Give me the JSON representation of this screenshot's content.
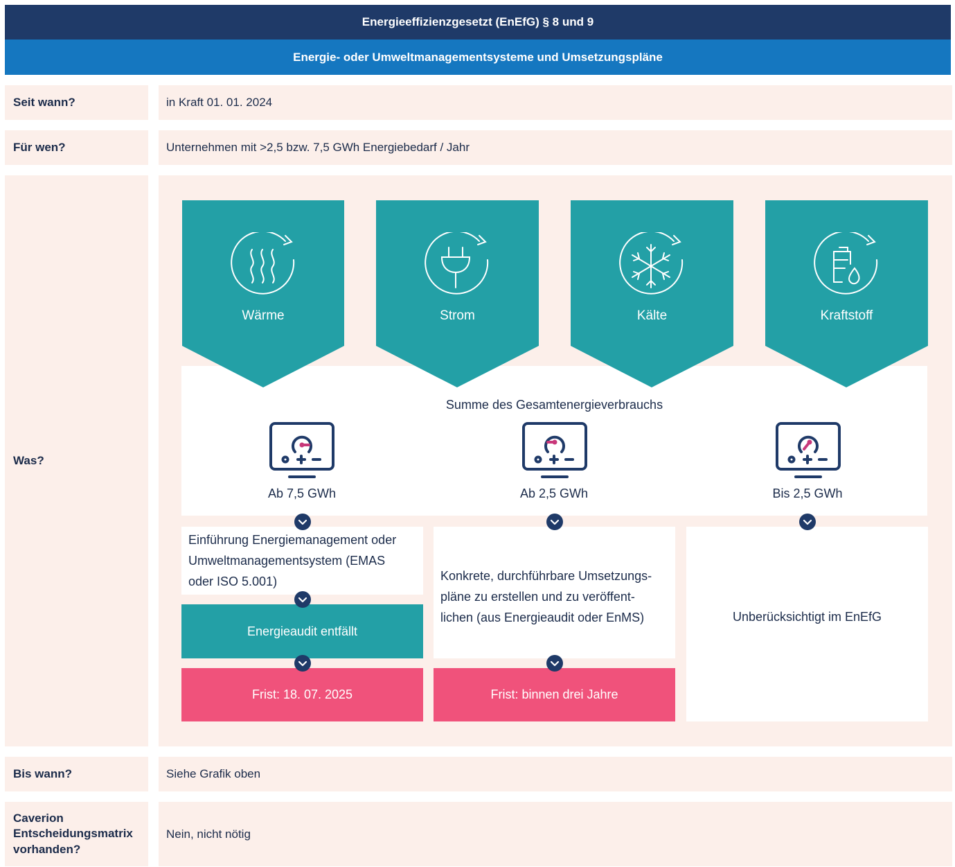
{
  "header": {
    "title": "Energieeffizienzgesetzt (EnEfG) § 8 und 9",
    "subtitle": "Energie- oder Umweltmanagementsysteme und Umsetzungspläne"
  },
  "rows": {
    "seit_wann": {
      "label": "Seit wann?",
      "value": "in Kraft 01. 01. 2024"
    },
    "fuer_wen": {
      "label": "Für wen?",
      "value": "Unternehmen mit >2,5 bzw. 7,5 GWh Energiebedarf / Jahr"
    },
    "was": {
      "label": "Was?"
    },
    "bis_wann": {
      "label": "Bis wann?",
      "value": "Siehe Grafik oben"
    },
    "matrix": {
      "label_1": "Caverion",
      "label_2": "Entscheidungsmatrix",
      "label_3": "vorhanden?",
      "value": "Nein, nicht nötig"
    }
  },
  "energy_types": [
    {
      "label": "Wärme",
      "icon": "heat-icon"
    },
    {
      "label": "Strom",
      "icon": "plug-icon"
    },
    {
      "label": "Kälte",
      "icon": "snowflake-icon"
    },
    {
      "label": "Kraftstoff",
      "icon": "fuel-icon"
    }
  ],
  "summary": {
    "title": "Summe des Gesamtenergieverbrauchs",
    "levels": [
      {
        "label": "Ab 7,5 GWh",
        "icon": "gauge-high-icon"
      },
      {
        "label": "Ab 2,5 GWh",
        "icon": "gauge-mid-icon"
      },
      {
        "label": "Bis 2,5 GWh",
        "icon": "gauge-low-icon"
      }
    ]
  },
  "outcomes": {
    "col1": {
      "line1": "Einführung Energiemanagement oder",
      "line2": "Umweltmanagementsystem (EMAS",
      "line3": "oder ISO 5.001)",
      "audit": "Energieaudit entfällt",
      "deadline": "Frist: 18. 07. 2025"
    },
    "col2": {
      "line1": "Konkrete, durchführbare Umsetzungs-",
      "line2": "pläne zu erstellen und zu veröffent-",
      "line3": "lichen (aus Energieaudit oder EnMS)",
      "deadline": "Frist: binnen drei Jahre"
    },
    "col3": {
      "text": "Unberücksichtigt im EnEfG"
    }
  },
  "colors": {
    "navy": "#1f3a68",
    "blue": "#1577c0",
    "teal": "#23a0a6",
    "pink": "#f0527b",
    "peach": "#fcefea",
    "gauge_accent": "#c8387a"
  }
}
